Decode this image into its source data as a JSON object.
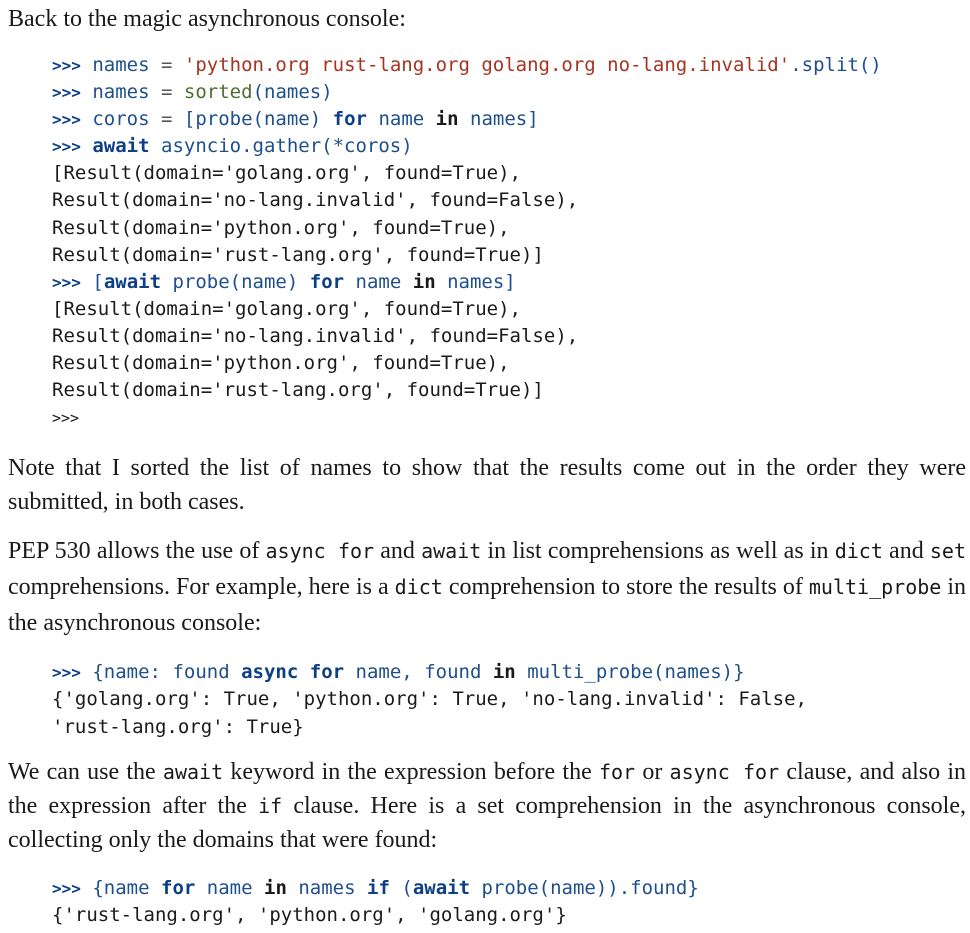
{
  "p1": "Back to the magic asynchronous console:",
  "code1": {
    "l1": {
      "prompt": ">>>",
      "a": "names",
      "eq": "=",
      "str": "'python.org rust-lang.org golang.org no-lang.invalid'",
      "tail": ".split()"
    },
    "l2": {
      "prompt": ">>>",
      "a": "names",
      "eq": "=",
      "fn": "sorted",
      "tail": "(names)"
    },
    "l3": {
      "prompt": ">>>",
      "a": "coros",
      "eq": "=",
      "b": "[probe(name)",
      "kw_for": "for",
      "name": "name",
      "kw_in": "in",
      "c": "names]"
    },
    "l4": {
      "prompt": ">>>",
      "kw_await": "await",
      "rest": "asyncio.gather(*coros)"
    },
    "out1": "[Result(domain='golang.org', found=True),\nResult(domain='no-lang.invalid', found=False),\nResult(domain='python.org', found=True),\nResult(domain='rust-lang.org', found=True)]",
    "l5": {
      "prompt": ">>>",
      "open": "[",
      "kw_await": "await",
      "call": "probe(name)",
      "kw_for": "for",
      "name": "name",
      "kw_in": "in",
      "c": "names]"
    },
    "out2": "[Result(domain='golang.org', found=True),\nResult(domain='no-lang.invalid', found=False),\nResult(domain='python.org', found=True),\nResult(domain='rust-lang.org', found=True)]",
    "l6": ">>>"
  },
  "p2": "Note that I sorted the list of names to show that the results come out in the order they were submitted, in both cases.",
  "p3": {
    "t1": "PEP 530 allows the use of ",
    "c1": "async for",
    "t2": " and ",
    "c2": "await",
    "t3": " in list comprehensions as well as in ",
    "c3": "dict",
    "t4": " and ",
    "c4": "set",
    "t5": " comprehensions. For example, here is a ",
    "c5": "dict",
    "t6": " comprehension to store the results of ",
    "c6": "multi_probe",
    "t7": " in the asynchronous console:"
  },
  "code2": {
    "prompt": ">>>",
    "open": "{name:",
    "found": "found",
    "kw_async": "async",
    "kw_for": "for",
    "name": "name,",
    "found2": "found",
    "kw_in": "in",
    "call": "multi_probe(names)}",
    "out": "{'golang.org': True, 'python.org': True, 'no-lang.invalid': False,\n'rust-lang.org': True}"
  },
  "p4": {
    "t1": "We can use the ",
    "c1": "await",
    "t2": " keyword in the expression before the ",
    "c2": "for",
    "t3": " or ",
    "c3": "async for",
    "t4": " clause, and also in the expression after the ",
    "c4": "if",
    "t5": " clause. Here is a set comprehension in the asynchronous console, collecting only the domains that were found:"
  },
  "code3": {
    "prompt": ">>>",
    "open": "{name",
    "kw_for": "for",
    "name": "name",
    "kw_in": "in",
    "names": "names",
    "kw_if": "if",
    "paren": "(",
    "kw_await": "await",
    "call": "probe(name)).found}",
    "out": "{'rust-lang.org', 'python.org', 'golang.org'}"
  }
}
